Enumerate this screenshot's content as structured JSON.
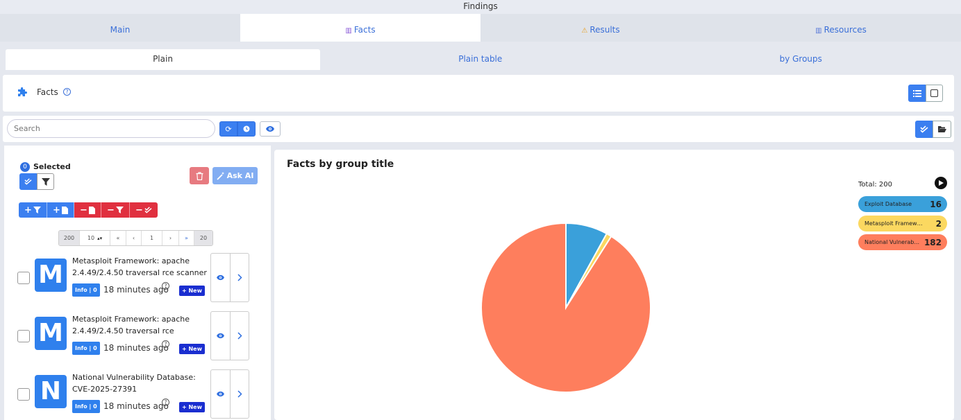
{
  "window": {
    "title": "Findings"
  },
  "main_tabs": [
    {
      "label": "Main",
      "icon": ""
    },
    {
      "label": "Facts",
      "icon": "facts-icon"
    },
    {
      "label": "Results",
      "icon": "warning-icon"
    },
    {
      "label": "Resources",
      "icon": "books-icon"
    }
  ],
  "sub_tabs": [
    {
      "label": "Plain"
    },
    {
      "label": "Plain table"
    },
    {
      "label": "by Groups"
    }
  ],
  "header": {
    "title": "Facts"
  },
  "search": {
    "placeholder": "Search",
    "value": ""
  },
  "selection": {
    "count": "0",
    "label": "Selected"
  },
  "toolbar": {
    "ask_ai_label": "Ask AI"
  },
  "pager": {
    "total": "200",
    "page_size": "10",
    "page": "1",
    "last": "20",
    "first_label": "«",
    "prev_label": "‹",
    "next_label": "›",
    "last_label": "»"
  },
  "findings": [
    {
      "logo": "M",
      "title": "Metasploit Framework: apache 2.4.49/2.4.50 traversal rce scanner",
      "info": "Info | 0",
      "time": "18 minutes ago",
      "badge": "+ New"
    },
    {
      "logo": "M",
      "title": "Metasploit Framework: apache 2.4.49/2.4.50 traversal rce",
      "info": "Info | 0",
      "time": "18 minutes ago",
      "badge": "+ New"
    },
    {
      "logo": "N",
      "title": "National Vulnerability Database: CVE-2025-27391",
      "info": "Info | 0",
      "time": "18 minutes ago",
      "badge": "+ New"
    }
  ],
  "chart_data": {
    "type": "pie",
    "title": "Facts by group title",
    "total_label": "Total: 200",
    "slices": [
      {
        "name": "Exploit Database",
        "value": 16,
        "color": "#3aa0da"
      },
      {
        "name": "Metasploit Framework",
        "value": 2,
        "color": "#fbd860"
      },
      {
        "name": "National Vulnerability Database",
        "value": 182,
        "color": "#fe7e5d"
      }
    ],
    "legend_labels": [
      "Exploit Database",
      "Metasploit Framework",
      "National Vulnerab..."
    ],
    "legend_placement": "top-right"
  },
  "colors": {
    "accent": "#3b7ff0",
    "danger": "#e0303f",
    "new_badge": "#1a2ed0"
  }
}
